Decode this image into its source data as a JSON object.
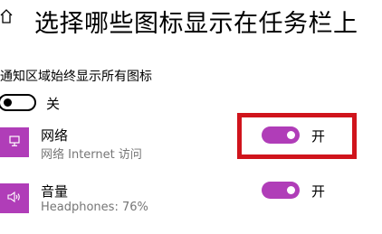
{
  "header": {
    "title": "选择哪些图标显示在任务栏上",
    "home_icon": "home-icon"
  },
  "always_show": {
    "label": "通知区域始终显示所有图标",
    "state_label": "关",
    "on": false
  },
  "items": [
    {
      "name": "网络",
      "subtitle": "网络 Internet 访问",
      "icon": "monitor-icon",
      "state_label": "开",
      "on": true
    },
    {
      "name": "音量",
      "subtitle": "Headphones: 76%",
      "icon": "speaker-icon",
      "state_label": "开",
      "on": true
    }
  ],
  "colors": {
    "accent": "#b03db8",
    "highlight": "#d0141c",
    "secondary_text": "#767676"
  }
}
